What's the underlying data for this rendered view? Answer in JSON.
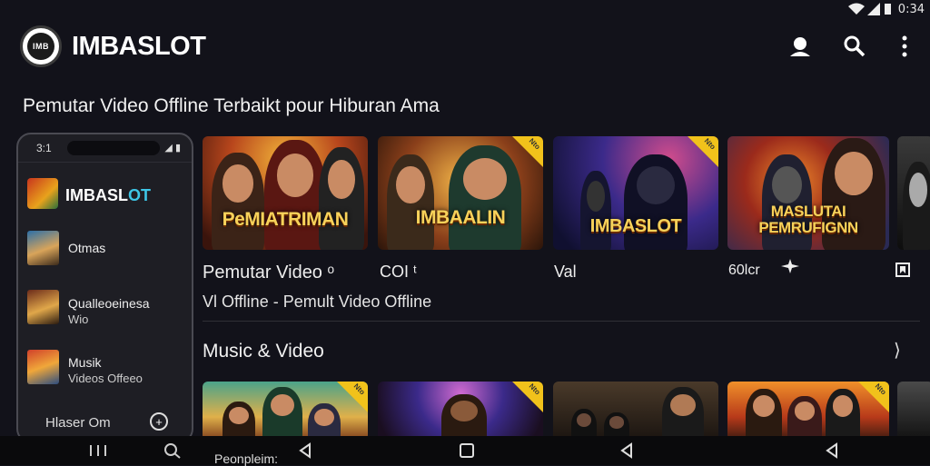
{
  "status": {
    "time": "0:34"
  },
  "app": {
    "name": "IMBASLOT",
    "logo_text": "IMB"
  },
  "subtitle": "Pemutar Video Offline Terbaikt pour Hiburan Ama",
  "phone": {
    "time": "3:1",
    "signal": "◢ ▮",
    "brand_prefix": "IMBASL",
    "brand_suffix": "OT",
    "items": [
      {
        "title": "Otmas",
        "subtitle": ""
      },
      {
        "title": "Qualleoeinesa",
        "subtitle": "Wio"
      },
      {
        "title": "Musik",
        "subtitle": "Videos Offeeo"
      }
    ],
    "footer": "Hlaser Om",
    "plus": "+"
  },
  "row1": {
    "cards": [
      {
        "text": "PeMIATRIMAN",
        "ribbon": ""
      },
      {
        "text": "IMBAALIN",
        "ribbon": "Nto"
      },
      {
        "text": "IMBASLOT",
        "ribbon": "Nto"
      },
      {
        "text": "MASLUTAI PEMRUFIGNN",
        "ribbon": ""
      },
      {
        "text": "",
        "ribbon": ""
      }
    ],
    "labels": [
      "Pemutar Video ᵒ",
      "COI ᵗ",
      "Val",
      "60lcr",
      ""
    ],
    "caption": "Vl Offline - Pemult Video Offline"
  },
  "section": {
    "title": "Music & Video",
    "arrow": "⟩"
  },
  "row2": {
    "cards": [
      {
        "ribbon": "Nto"
      },
      {
        "ribbon": "Nto"
      },
      {
        "ribbon": ""
      },
      {
        "ribbon": "Nto"
      },
      {
        "ribbon": ""
      }
    ]
  },
  "nav": {
    "peek_label": "Peonpleim:"
  },
  "colors": {
    "background": "#12121a",
    "accent_gold": "#f1c21b",
    "accent_cyan": "#3ec6e6"
  }
}
